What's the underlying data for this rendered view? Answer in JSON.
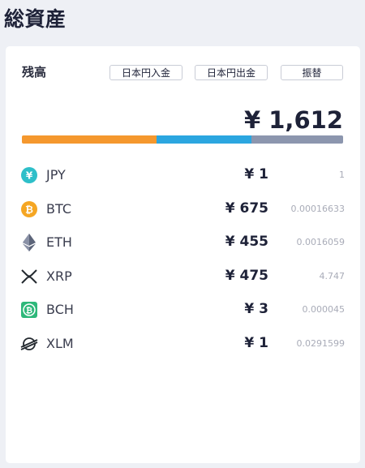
{
  "page_title": "総資産",
  "card": {
    "balance_label": "残高",
    "buttons": {
      "deposit_label": "日本円入金",
      "withdraw_label": "日本円出金",
      "transfer_label": "振替"
    },
    "total": "¥ 1,612"
  },
  "allocation_bar": [
    {
      "color": "#f5982e",
      "value": 0.42
    },
    {
      "color": "#2ba6e0",
      "value": 0.295
    },
    {
      "color": "#8c96ae",
      "value": 0.285
    }
  ],
  "assets": [
    {
      "symbol": "JPY",
      "value": "¥ 1",
      "amount": "1",
      "icon": "jpy-icon",
      "color": "#2ebfc9"
    },
    {
      "symbol": "BTC",
      "value": "¥ 675",
      "amount": "0.00016633",
      "icon": "btc-icon",
      "color": "#f5a623"
    },
    {
      "symbol": "ETH",
      "value": "¥ 455",
      "amount": "0.0016059",
      "icon": "eth-icon",
      "color": "#5c6479"
    },
    {
      "symbol": "XRP",
      "value": "¥ 475",
      "amount": "4.747",
      "icon": "xrp-icon",
      "color": "#23292f"
    },
    {
      "symbol": "BCH",
      "value": "¥ 3",
      "amount": "0.000045",
      "icon": "bch-icon",
      "color": "#2eb87a"
    },
    {
      "symbol": "XLM",
      "value": "¥ 1",
      "amount": "0.0291599",
      "icon": "xlm-icon",
      "color": "#23292f"
    }
  ]
}
